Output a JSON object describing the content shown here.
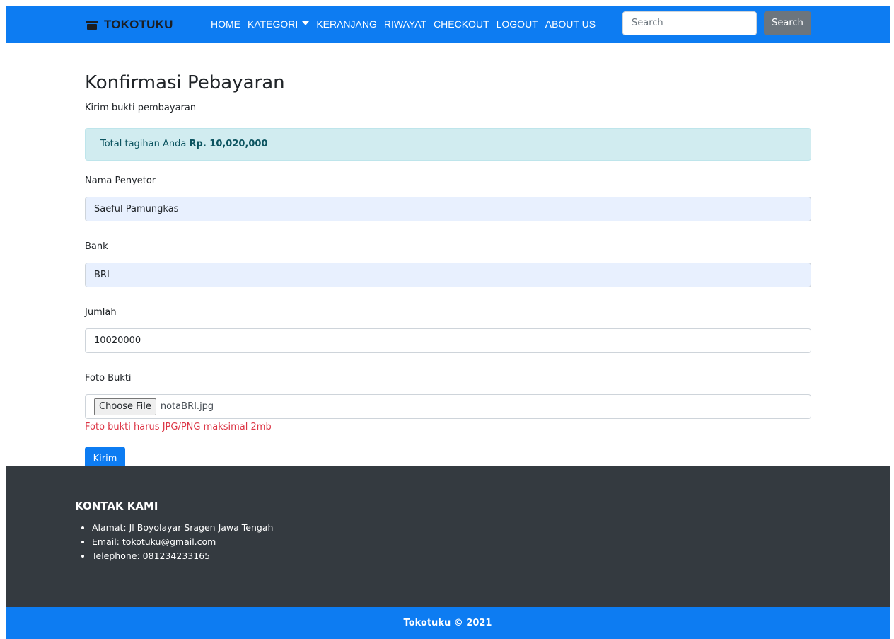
{
  "nav": {
    "brand": "TOKOTUKU",
    "links": [
      "HOME",
      "KATEGORI",
      "KERANJANG",
      "RIWAYAT",
      "CHECKOUT",
      "LOGOUT",
      "ABOUT US"
    ],
    "search_placeholder": "Search",
    "search_button": "Search"
  },
  "page": {
    "title": "Konfirmasi Pebayaran",
    "subtitle": "Kirim bukti pembayaran",
    "alert_text": "Total tagihan Anda",
    "alert_amount": "Rp. 10,020,000"
  },
  "form": {
    "nama_label": "Nama Penyetor",
    "nama_value": "Saeful Pamungkas",
    "bank_label": "Bank",
    "bank_value": "BRI",
    "jumlah_label": "Jumlah",
    "jumlah_value": "10020000",
    "foto_label": "Foto Bukti",
    "choose_file": "Choose File",
    "file_name": "notaBRI.jpg",
    "hint": "Foto bukti harus JPG/PNG maksimal 2mb",
    "submit": "Kirim"
  },
  "footer": {
    "heading": "KONTAK KAMI",
    "items": [
      "Alamat: Jl Boyolayar Sragen Jawa Tengah",
      "Email: tokotuku@gmail.com",
      "Telephone: 081234233165"
    ],
    "copyright": "Tokotuku © 2021"
  },
  "colors": {
    "primary": "#0d7cf2",
    "footer": "#343a40",
    "alert_bg": "#d1ecf0",
    "danger": "#dc3545"
  }
}
